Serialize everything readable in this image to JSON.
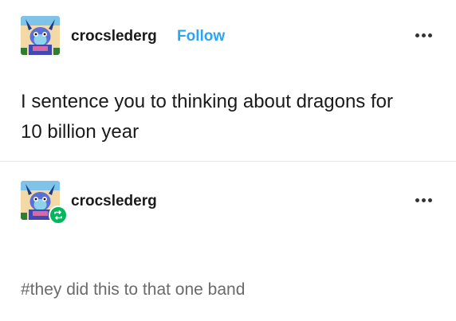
{
  "post": {
    "username": "crocslederg",
    "follow_label": "Follow",
    "more_icon": "ellipsis-icon",
    "text_line_1": "I sentence you to thinking about dragons for",
    "text_line_2": "10 billion year"
  },
  "reblog": {
    "username": "crocslederg",
    "badge_icon": "reblog-icon",
    "more_icon": "ellipsis-icon",
    "badge_color": "#00b85c"
  },
  "tags": {
    "tag_1": "#they did this to that one band"
  },
  "colors": {
    "follow": "#2ba4f5",
    "tag": "#6a6a6a",
    "divider": "#e6e6e6"
  }
}
